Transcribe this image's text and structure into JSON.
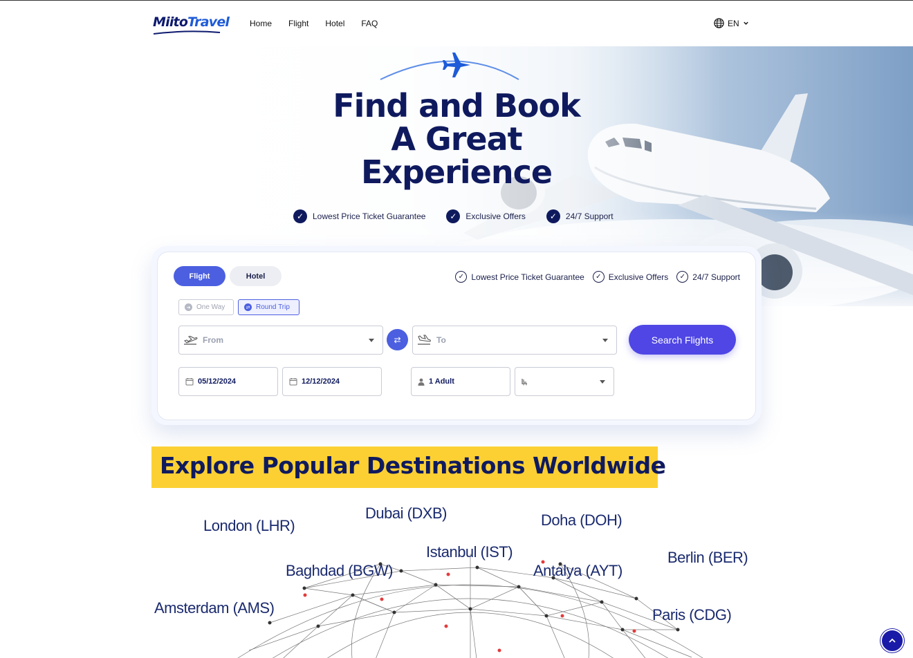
{
  "brand": {
    "logo_part1": "Miito",
    "logo_part2": "Travel"
  },
  "nav": {
    "items": [
      "Home",
      "Flight",
      "Hotel",
      "FAQ"
    ]
  },
  "language": {
    "label": "EN"
  },
  "hero": {
    "title_line1": "Find and Book",
    "title_line2": "A Great",
    "title_line3": "Experience",
    "features": [
      "Lowest Price Ticket Guarantee",
      "Exclusive Offers",
      "24/7 Support"
    ]
  },
  "search": {
    "tabs": [
      "Flight",
      "Hotel"
    ],
    "active_tab": "Flight",
    "features": [
      "Lowest Price Ticket Guarantee",
      "Exclusive Offers",
      "24/7 Support"
    ],
    "trip_types": [
      "One Way",
      "Round Trip"
    ],
    "selected_trip": "Round Trip",
    "from_label": "From",
    "to_label": "To",
    "depart_date": "05/12/2024",
    "return_date": "12/12/2024",
    "passengers": "1 Adult",
    "cabin_class": "",
    "button_label": "Search Flights"
  },
  "destinations": {
    "title": "Explore Popular Destinations Worldwide",
    "cities": [
      "London (LHR)",
      "Dubai (DXB)",
      "Doha (DOH)",
      "Istanbul (IST)",
      "Berlin (BER)",
      "Baghdad (BGW)",
      "Antalya (AYT)",
      "Amsterdam (AMS)",
      "Paris (CDG)"
    ]
  },
  "colors": {
    "navy": "#0f1a5e",
    "accent": "#4b5fe0",
    "button": "#4f46e5",
    "highlight": "#fcd033"
  },
  "icons": [
    "globe-icon",
    "chevron-down-icon",
    "plane-icon",
    "check-icon",
    "takeoff-icon",
    "landing-icon",
    "swap-icon",
    "calendar-icon",
    "person-icon",
    "seat-icon",
    "arrow-up-icon"
  ]
}
